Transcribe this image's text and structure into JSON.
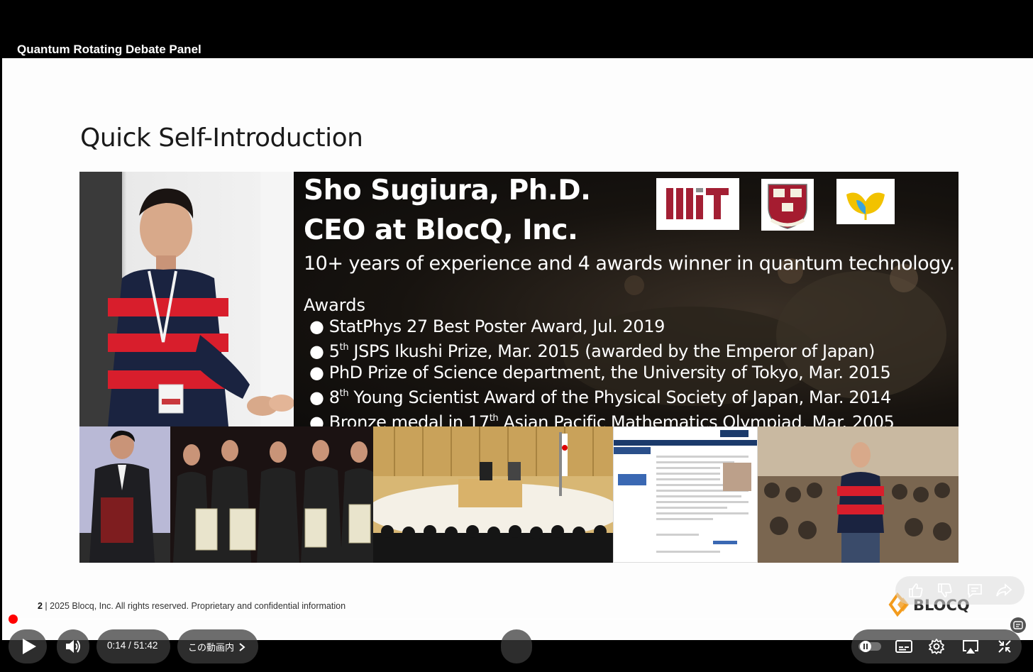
{
  "video": {
    "title": "Quantum Rotating Debate Panel"
  },
  "slide": {
    "heading": "Quick Self-Introduction",
    "name": "Sho Sugiura, Ph.D.",
    "role": "CEO at BlocQ, Inc.",
    "summary": "10+ years of experience and 4 awards winner in quantum technology.",
    "awards_heading": "Awards",
    "awards": [
      {
        "pre": "StatPhys 27 Best Poster Award, Jul. 2019",
        "sup": "",
        "post": ""
      },
      {
        "pre": "5",
        "sup": "th",
        "post": " JSPS Ikushi Prize, Mar. 2015 (awarded by the Emperor of Japan)"
      },
      {
        "pre": "PhD Prize of Science department, the University of Tokyo, Mar. 2015",
        "sup": "",
        "post": ""
      },
      {
        "pre": "8",
        "sup": "th",
        "post": " Young Scientist Award of the Physical Society of Japan, Mar. 2014"
      },
      {
        "pre": "Bronze medal in 17",
        "sup": "th",
        "post": " Asian Pacific Mathematics Olympiad, Mar. 2005"
      }
    ],
    "logos": {
      "mit": "MIT",
      "harvard_motto": "VE RI TAS",
      "harvard": "HARVARD"
    },
    "footer_page": "2",
    "footer_text": " | 2025 Blocq, Inc. All rights reserved. Proprietary and confidential information",
    "brand": "BLOCQ"
  },
  "player": {
    "current_time": "0:14",
    "separator": " / ",
    "duration": "51:42",
    "chapter": "この動画内",
    "progress": 0.0045,
    "accent": "#ff0000"
  },
  "reactions": [
    "like-icon",
    "dislike-icon",
    "comment-icon",
    "share-icon"
  ],
  "controls": [
    "play-icon",
    "volume-icon",
    "autoplay-toggle",
    "subtitles-icon",
    "settings-icon",
    "airplay-icon",
    "exit-fullscreen-icon"
  ]
}
